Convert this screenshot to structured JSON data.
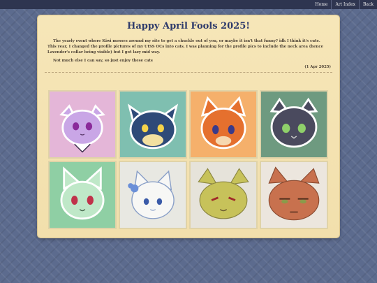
{
  "nav": {
    "home": "Home",
    "art_index": "Art Index",
    "back": "Back"
  },
  "post": {
    "title": "Happy April Fools 2025!",
    "paragraph1": "The yearly event where Kiwi messes around my site to get a chuckle out of you, or maybe it isn't that funny? idk I think it's cute. This year, I changed the profile pictures of my UtSS OCs into cats. I was planning for the profile pics to include the neck area (hence Lavender's collar being visible) but I got lazy mid way.",
    "paragraph2": "Not much else I can say, so just enjoy these cats",
    "date": "(1 Apr 2025)"
  },
  "gallery": [
    {
      "icon": "lavender-cat-icon",
      "bg": "#e4b6d8"
    },
    {
      "icon": "dark-blue-cat-icon",
      "bg": "#7fbfb0"
    },
    {
      "icon": "orange-cat-icon",
      "bg": "#f5b06b"
    },
    {
      "icon": "gray-cat-icon",
      "bg": "#6e9a80"
    },
    {
      "icon": "green-cat-icon",
      "bg": "#8fcfa4"
    },
    {
      "icon": "white-flower-cat-icon",
      "bg": "#e8e8e2"
    },
    {
      "icon": "yellow-cat-sketch-icon",
      "bg": "#e6e3da"
    },
    {
      "icon": "red-cat-sketch-icon",
      "bg": "#ece6de"
    }
  ]
}
